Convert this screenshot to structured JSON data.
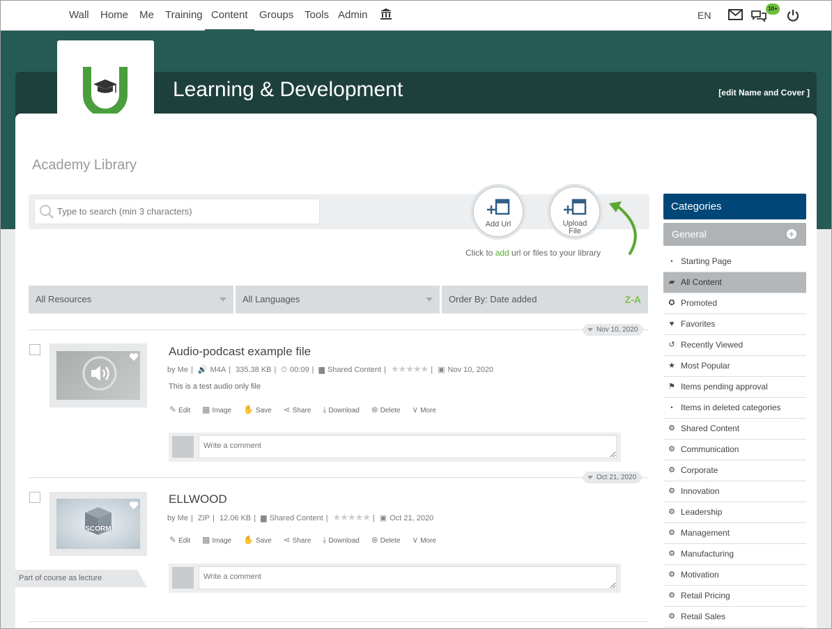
{
  "nav": {
    "items": [
      "Wall",
      "Home",
      "Me",
      "Training",
      "Content",
      "Groups",
      "Tools",
      "Admin"
    ],
    "active": "Content",
    "language": "EN",
    "chat_badge": "10+"
  },
  "banner": {
    "title": "Learning & Development",
    "edit_link": "[edit Name and Cover ]"
  },
  "library": {
    "title": "Academy Library",
    "search_placeholder": "Type to search (min 3 characters)",
    "add_url_label": "Add Url",
    "upload_file_label": "Upload\nFile",
    "hint_before": "Click to ",
    "hint_add": "add",
    "hint_after": " url or files to your library"
  },
  "filters": {
    "resources": "All Resources",
    "languages": "All Languages",
    "order_by": "Order By: Date added",
    "sort_label": "Z-A"
  },
  "items": [
    {
      "date_badge": "Nov 10, 2020",
      "title": "Audio-podcast example file",
      "by": "by Me",
      "type": "M4A",
      "size": "335.38 KB",
      "duration": "00:09",
      "shared": "Shared Content",
      "date": "Nov 10, 2020",
      "description": "This is a test audio only file",
      "comment_placeholder": "Write a comment"
    },
    {
      "date_badge": "Oct 21, 2020",
      "title": "ELLWOOD",
      "by": "by Me",
      "type": "ZIP",
      "size": "12.06 KB",
      "shared": "Shared Content",
      "date": "Oct 21, 2020",
      "thumb_label": "SCORM",
      "ribbon": "Part of course as lecture",
      "comment_placeholder": "Write a comment"
    }
  ],
  "actions": [
    "Edit",
    "Image",
    "Save",
    "Share",
    "Download",
    "Delete",
    "More"
  ],
  "categories": {
    "header": "Categories",
    "general": "General",
    "items": [
      {
        "label": "Starting Page",
        "icon": "bullet"
      },
      {
        "label": "All Content",
        "icon": "folder-icon",
        "selected": true
      },
      {
        "label": "Promoted",
        "icon": "ribbon-icon"
      },
      {
        "label": "Favorites",
        "icon": "heart-icon"
      },
      {
        "label": "Recently Viewed",
        "icon": "history-icon"
      },
      {
        "label": "Most Popular",
        "icon": "star-icon"
      },
      {
        "label": "Items pending approval",
        "icon": "pending-icon"
      },
      {
        "label": "Items in deleted categories",
        "icon": "bullet"
      },
      {
        "label": "Shared Content",
        "icon": "gears-icon"
      },
      {
        "label": "Communication",
        "icon": "gears-icon"
      },
      {
        "label": "Corporate",
        "icon": "gears-icon"
      },
      {
        "label": "Innovation",
        "icon": "gears-icon"
      },
      {
        "label": "Leadership",
        "icon": "gears-icon"
      },
      {
        "label": "Management",
        "icon": "gears-icon"
      },
      {
        "label": "Manufacturing",
        "icon": "gears-icon"
      },
      {
        "label": "Motivation",
        "icon": "gears-icon"
      },
      {
        "label": "Retail Pricing",
        "icon": "gears-icon"
      },
      {
        "label": "Retail Sales",
        "icon": "gears-icon"
      }
    ]
  },
  "colors": {
    "brand_green": "#5aa832",
    "banner": "#265a55",
    "category_header": "#004778"
  }
}
